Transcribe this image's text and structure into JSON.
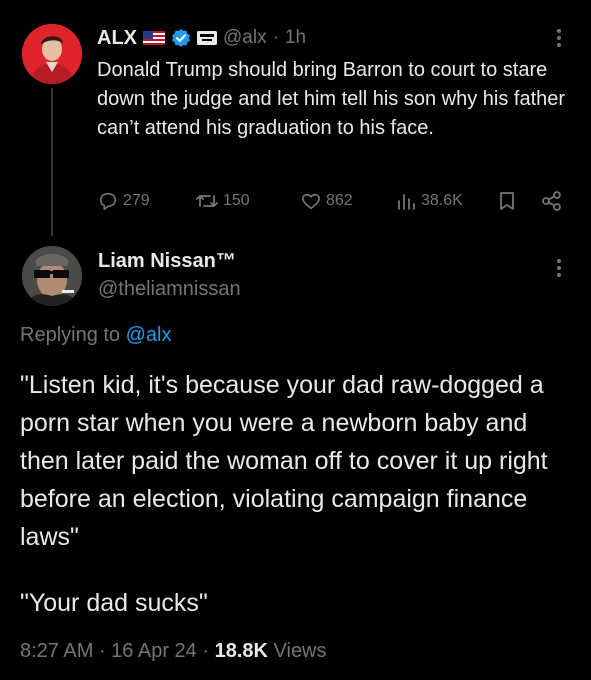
{
  "parent_post": {
    "author_name": "ALX",
    "author_handle": "@alx",
    "separator": "·",
    "time": "1h",
    "text": "Donald Trump should bring Barron to court to stare down the judge and let him tell his son why his father can’t attend his graduation to his face.",
    "stats": {
      "replies": "279",
      "reposts": "150",
      "likes": "862",
      "views": "38.6K"
    }
  },
  "reply_post": {
    "author_name": "Liam Nissan™",
    "author_handle": "@theliamnissan",
    "replying_prefix": "Replying to",
    "replying_to": "@alx",
    "text_main": "\"Listen kid, it's because your dad raw-dogged a porn star when you were a newborn baby and then later paid the woman off to cover it up right before an election, violating campaign finance laws\"",
    "text_second": "\"Your dad sucks\"",
    "time": "8:27 AM",
    "date": "16 Apr 24",
    "separator": " · ",
    "views_count": "18.8K",
    "views_label": "Views"
  },
  "colors": {
    "background": "#000000",
    "text_primary": "#e7e9ea",
    "text_secondary": "#71767b",
    "link": "#1d9bf0",
    "verified": "#1d9bf0"
  },
  "icons": [
    "us-flag-icon",
    "verified-badge-icon",
    "affiliate-badge-icon",
    "more-icon",
    "reply-icon",
    "repost-icon",
    "like-icon",
    "views-icon",
    "bookmark-icon",
    "share-icon"
  ]
}
